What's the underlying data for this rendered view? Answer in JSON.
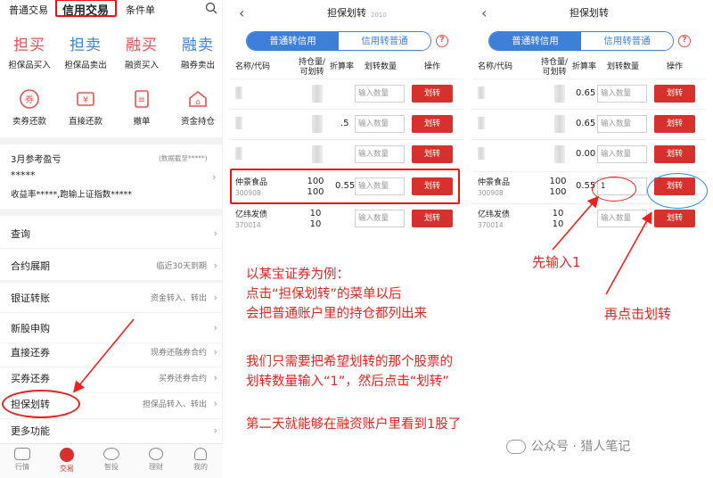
{
  "left_panel": {
    "tabs": [
      "普通交易",
      "信用交易",
      "条件单"
    ],
    "actions_row1": [
      {
        "title": "担买",
        "label": "担保品买入",
        "color": "#e8504f"
      },
      {
        "title": "担卖",
        "label": "担保品卖出",
        "color": "#3d7fd9"
      },
      {
        "title": "融买",
        "label": "融资买入",
        "color": "#e8504f"
      },
      {
        "title": "融卖",
        "label": "融券卖出",
        "color": "#3d7fd9"
      }
    ],
    "actions_row2": [
      {
        "icon": "coupon-icon",
        "glyph": "券",
        "label": "卖券还款"
      },
      {
        "icon": "repay-icon",
        "glyph": "¥",
        "label": "直接还款"
      },
      {
        "icon": "cancel-order-icon",
        "glyph": "≡",
        "label": "撤单"
      },
      {
        "icon": "holdings-icon",
        "glyph": "⌂",
        "label": "资金持仓"
      }
    ],
    "profit": {
      "title": "3月参考盈亏",
      "as_of": "(数据截至*****)",
      "value": "*****",
      "detail": "收益率*****,跑输上证指数*****"
    },
    "menu": [
      {
        "label": "查询",
        "right": ""
      },
      {
        "label": "合约展期",
        "right": "临近30天到期"
      },
      {
        "label": "银证转账",
        "right": "资金转入、转出"
      },
      {
        "label": "新股申购",
        "right": ""
      },
      {
        "label": "直接还券",
        "right": "现券还融券合约"
      },
      {
        "label": "买券还券",
        "right": "买券还券合约"
      },
      {
        "label": "担保划转",
        "right": "担保品转入、转出"
      },
      {
        "label": "更多功能",
        "right": ""
      }
    ],
    "bottom_tabs": [
      {
        "label": "行情",
        "icon": "market-icon"
      },
      {
        "label": "交易",
        "icon": "trade-icon"
      },
      {
        "label": "智投",
        "icon": "smart-invest-icon"
      },
      {
        "label": "理财",
        "icon": "wealth-icon"
      },
      {
        "label": "我的",
        "icon": "profile-icon"
      }
    ]
  },
  "panel2": {
    "title": "担保划转",
    "title_suffix": "2010",
    "seg": [
      "普通转信用",
      "信用转普通"
    ],
    "headers": [
      "名称/代码",
      "持仓量/\n可划转",
      "折算率",
      "划转数量",
      "操作"
    ],
    "rows": [
      {
        "name": "",
        "code": "",
        "qty": "",
        "avail": "",
        "rate": "",
        "input": "输入数量",
        "btn": "划转",
        "blurred": true
      },
      {
        "name": "",
        "code": "",
        "qty": "",
        "avail": "",
        "rate": ".5",
        "input": "输入数量",
        "btn": "划转",
        "blurred": true
      },
      {
        "name": "",
        "code": "",
        "qty": "",
        "avail": "",
        "rate": "",
        "input": "输入数量",
        "btn": "划转",
        "blurred": true
      },
      {
        "name": "仲景食品",
        "code": "300908",
        "qty": "100",
        "avail": "100",
        "rate": "0.55",
        "input": "输入数量",
        "btn": "划转",
        "blurred": false
      },
      {
        "name": "亿纬发债",
        "code": "370014",
        "qty": "10",
        "avail": "10",
        "rate": "",
        "input": "输入数量",
        "btn": "划转",
        "blurred": false
      }
    ]
  },
  "panel3": {
    "title": "担保划转",
    "seg": [
      "普通转信用",
      "信用转普通"
    ],
    "headers": [
      "名称/代码",
      "持仓量/\n可划转",
      "折算率",
      "划转数量",
      "操作"
    ],
    "rows": [
      {
        "name": "",
        "code": "",
        "qty": "",
        "avail": "",
        "rate": "0.65",
        "input": "输入数量",
        "btn": "划转",
        "blurred": true
      },
      {
        "name": "",
        "code": "",
        "qty": "",
        "avail": "",
        "rate": "0.65",
        "input": "输入数量",
        "btn": "划转",
        "blurred": true
      },
      {
        "name": "",
        "code": "",
        "qty": "",
        "avail": "",
        "rate": "0.00",
        "input": "输入数量",
        "btn": "划转",
        "blurred": true
      },
      {
        "name": "仲景食品",
        "code": "300908",
        "qty": "100",
        "avail": "100",
        "rate": "0.55",
        "input": "1",
        "btn": "划转",
        "blurred": false
      },
      {
        "name": "亿纬发债",
        "code": "370014",
        "qty": "10",
        "avail": "10",
        "rate": "",
        "input": "输入数量",
        "btn": "划转",
        "blurred": false
      }
    ]
  },
  "annotations": {
    "step1": "先输入1",
    "step2": "再点击划转",
    "para1": [
      "以某宝证券为例：",
      "点击“担保划转”的菜单以后",
      "会把普通账户里的持仓都列出来"
    ],
    "para2": [
      "我们只需要把希望划转的那个股票的",
      "划转数量输入“1”，然后点击“划转”"
    ],
    "para3": "第二天就能够在融资账户里看到1股了",
    "watermark": "公众号 · 猎人笔记",
    "color": "#e8221e"
  }
}
